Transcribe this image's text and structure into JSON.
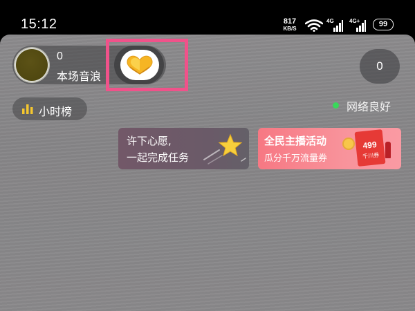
{
  "status_bar": {
    "time": "15:12",
    "net_speed_value": "817",
    "net_speed_unit": "KB/S",
    "signal_1_label": "4G",
    "signal_2_label": "4G+",
    "battery_level": "99"
  },
  "room": {
    "host_count": "0",
    "host_name": "本场音浪",
    "viewer_count": "0",
    "hourly_rank_label": "小时榜",
    "network_status": "网络良好"
  },
  "banners": {
    "wish_line1": "许下心愿,",
    "wish_line2": "一起完成任务",
    "event_title": "全民主播活动",
    "event_subtitle": "瓜分千万流量券",
    "ticket_value": "499",
    "ticket_label": "千川券"
  },
  "icons": {
    "gift": "gift-icon",
    "hourly_rank": "bar-chart-icon",
    "wish": "shooting-star-icon"
  },
  "colors": {
    "highlight_box": "#f0528a",
    "network_dot": "#39d85a",
    "event_banner": "#f77883"
  }
}
